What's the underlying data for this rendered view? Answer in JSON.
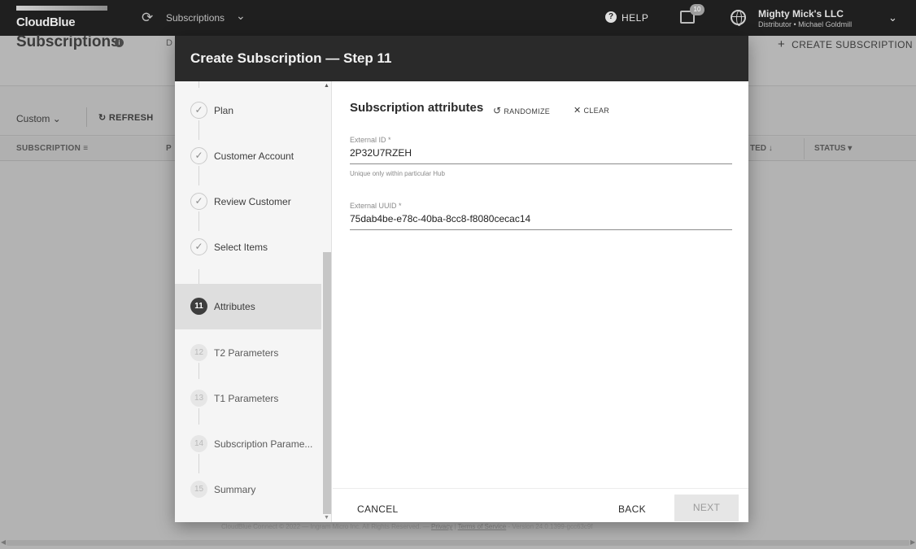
{
  "topbar": {
    "logo_text": "CloudBlue",
    "module_label": "Subscriptions",
    "help_label": "HELP",
    "notifications_count": "10",
    "account_name": "Mighty Mick's LLC",
    "account_subtitle": "Distributor • Michael Goldmill"
  },
  "background": {
    "page_title": "Subscriptions",
    "tab_peek": "D",
    "create_button": "CREATE SUBSCRIPTION",
    "filter_custom": "Custom",
    "refresh_label": "REFRESH",
    "columns": {
      "subscription": "SUBSCRIPTION",
      "peek": "P",
      "created_peek": "TED",
      "status": "STATUS"
    },
    "footer_text": "CloudBlue Connect © 2022 — Ingram Micro Inc. All Rights Reserved. —",
    "footer_privacy": "Privacy",
    "footer_terms": "Terms of Service",
    "footer_version": "Version 24.0.1399-gcc63c9f"
  },
  "modal": {
    "title": "Create Subscription — Step 11",
    "steps": [
      {
        "number": "",
        "label": "Plan",
        "state": "done"
      },
      {
        "number": "",
        "label": "Customer Account",
        "state": "done"
      },
      {
        "number": "",
        "label": "Review Customer",
        "state": "done"
      },
      {
        "number": "",
        "label": "Select Items",
        "state": "done"
      },
      {
        "number": "11",
        "label": "Attributes",
        "state": "active"
      },
      {
        "number": "12",
        "label": "T2 Parameters",
        "state": "todo"
      },
      {
        "number": "13",
        "label": "T1 Parameters",
        "state": "todo"
      },
      {
        "number": "14",
        "label": "Subscription Parame...",
        "state": "todo"
      },
      {
        "number": "15",
        "label": "Summary",
        "state": "todo"
      }
    ],
    "section_title": "Subscription attributes",
    "randomize_label": "RANDOMIZE",
    "clear_label": "CLEAR",
    "fields": {
      "external_id": {
        "label": "External ID *",
        "value": "2P32U7RZEH",
        "help": "Unique only within particular Hub"
      },
      "external_uuid": {
        "label": "External UUID *",
        "value": "75dab4be-e78c-40ba-8cc8-f8080cecac14"
      }
    },
    "actions": {
      "cancel": "CANCEL",
      "back": "BACK",
      "next": "NEXT"
    }
  }
}
